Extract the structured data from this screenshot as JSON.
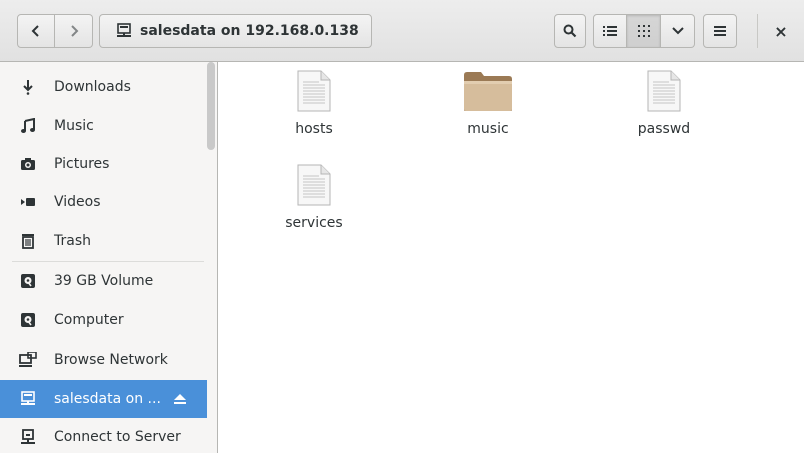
{
  "header": {
    "back_icon": "chevron-left-icon",
    "forward_icon": "chevron-right-icon",
    "location_prefix": "salesdata on ",
    "location_host": "192.168.0.138",
    "location_icon": "network-share-icon",
    "search_icon": "search-icon",
    "list_view_icon": "list-view-icon",
    "grid_view_icon": "grid-view-icon",
    "view_options_icon": "chevron-down-icon",
    "menu_icon": "hamburger-menu-icon",
    "close_label": "×"
  },
  "sidebar": {
    "items": [
      {
        "label": "Downloads",
        "icon": "downloads-icon"
      },
      {
        "label": "Music",
        "icon": "music-icon"
      },
      {
        "label": "Pictures",
        "icon": "camera-icon"
      },
      {
        "label": "Videos",
        "icon": "video-icon"
      },
      {
        "label": "Trash",
        "icon": "trash-icon"
      },
      {
        "label": "39 GB Volume",
        "icon": "drive-icon"
      },
      {
        "label": "Computer",
        "icon": "drive-icon"
      },
      {
        "label": "Browse Network",
        "icon": "network-icon"
      },
      {
        "label": "salesdata on ...",
        "icon": "network-share-icon",
        "active": true
      },
      {
        "label": "Connect to Server",
        "icon": "server-icon"
      }
    ]
  },
  "files": [
    {
      "name": "hosts",
      "type": "document"
    },
    {
      "name": "music",
      "type": "folder"
    },
    {
      "name": "passwd",
      "type": "document"
    },
    {
      "name": "services",
      "type": "document"
    }
  ],
  "colors": {
    "accent": "#4a90d9",
    "folder": "#c9a982",
    "sidebar_bg": "#f6f5f4"
  }
}
